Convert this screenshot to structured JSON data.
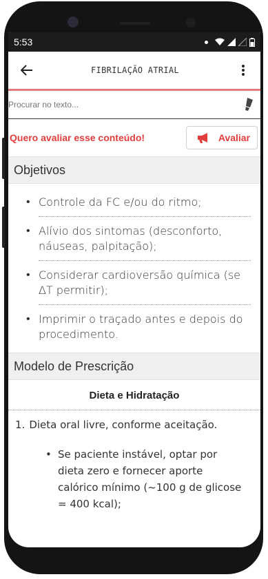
{
  "status_bar": {
    "time": "5:53"
  },
  "app_bar": {
    "title": "FIBRILAÇÃO ATRIAL"
  },
  "search": {
    "placeholder": "Procurar no texto..."
  },
  "evaluate": {
    "prompt": "Quero avaliar esse conteúdo!",
    "button_label": "Avaliar"
  },
  "objetivos": {
    "header": "Objetivos",
    "items": [
      "Controle da FC e/ou do ritmo;",
      "Alívio dos sintomas (desconforto, náuseas, palpitação);",
      "Considerar cardioversão química (se ΔT permitir);",
      "Imprimir o traçado antes e depois do procedimento."
    ]
  },
  "prescricao": {
    "header": "Modelo de Prescrição",
    "subsection": "Dieta e Hidratação",
    "items": [
      {
        "number": "1.",
        "text": "Dieta oral livre, conforme aceitação."
      }
    ],
    "sub_items": [
      "Se paciente instável, optar por dieta zero e fornecer aporte calórico mínimo (~100 g de glicose = 400 kcal);"
    ]
  },
  "colors": {
    "accent": "#e23d3d",
    "divider": "#e47b7b",
    "section_bg": "#efefef"
  }
}
